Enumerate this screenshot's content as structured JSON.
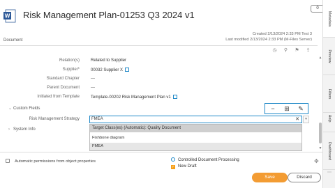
{
  "header": {
    "title": "Risk Management Plan-01253 Q3 2024 v1",
    "doc_type": "Document",
    "created": "Created 2/13/2024 2:33 PM Test 3",
    "modified": "Last modified 2/13/2024 2:33 PM (M-Files Server)",
    "word_icon_letter": "W",
    "badge_count": "0"
  },
  "properties": [
    {
      "label": "Relation(s)",
      "value": "Related to Supplier",
      "link": false
    },
    {
      "label": "Supplier*",
      "value": "00032 Supplier X",
      "link": true
    },
    {
      "label": "Standard Chapter",
      "value": "---",
      "link": false
    },
    {
      "label": "Parent Document",
      "value": "---",
      "link": false
    },
    {
      "label": "Initiated from Template",
      "value": "Template-00202 Risk Management Plan v1",
      "link": true
    }
  ],
  "sections": {
    "custom_fields": "Custom Fields",
    "system_info": "System Info"
  },
  "field": {
    "label": "Risk Management Strategy",
    "value": "FMEA",
    "clear_glyph": "✕",
    "dropdown_glyph": "▾"
  },
  "field_toolbar": {
    "remove_glyph": "−",
    "grid_glyph": "⊞",
    "edit_glyph": "✎"
  },
  "dropdown": {
    "header": "Target Class(es) (Automatic): Quality Document",
    "items": [
      "Fishbone diagram",
      "FMEA"
    ],
    "selected": "FMEA"
  },
  "footer": {
    "permissions": "Automatic permissions from object properties",
    "workflow": "Controlled Document Processing",
    "state": "New Draft",
    "save": "Save",
    "discard": "Discard"
  },
  "rightbar": {
    "tabs": [
      "Metadata",
      "Preview",
      "Filters",
      "Help",
      "Dashboard"
    ],
    "active": "Metadata"
  },
  "toolbar_icons": [
    "clock-icon",
    "pin-icon",
    "flag-icon",
    "share-icon"
  ],
  "colors": {
    "accent": "#1e88c7",
    "save": "#f39c33",
    "word": "#2b5797"
  }
}
